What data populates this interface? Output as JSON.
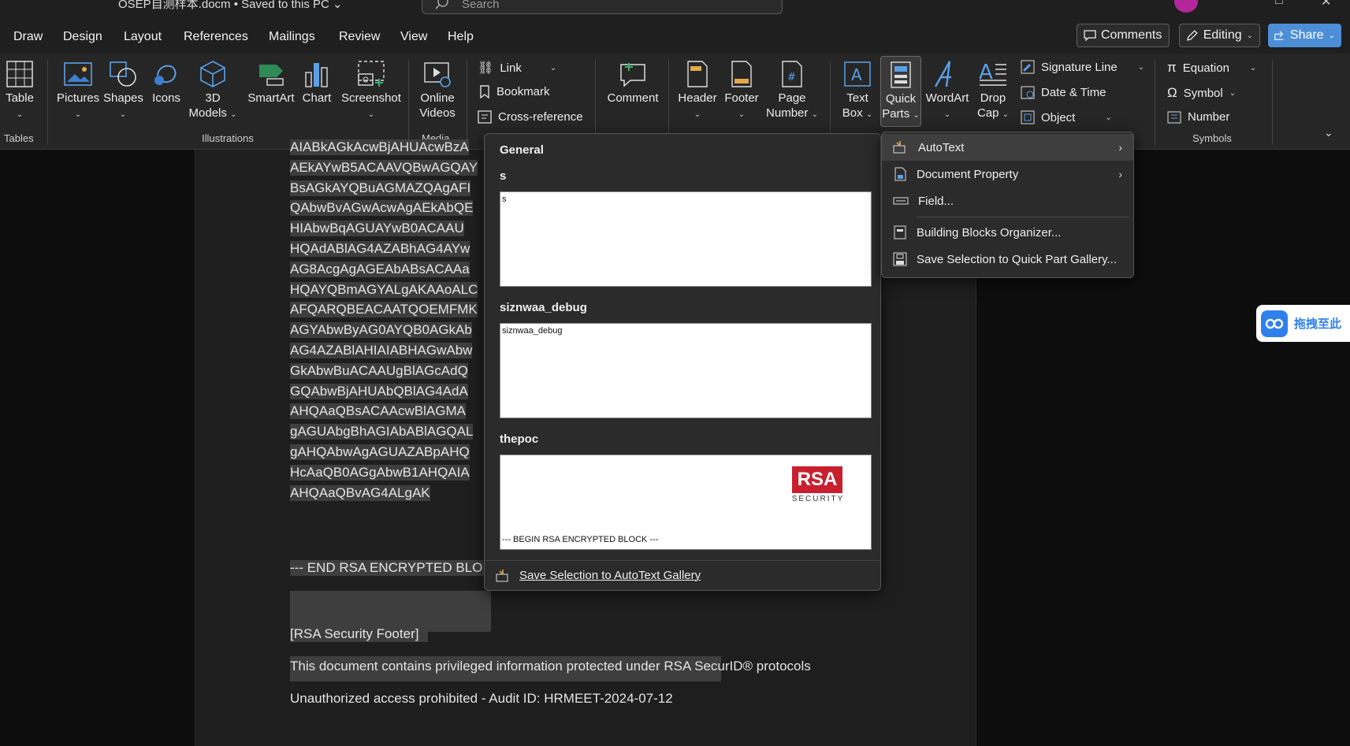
{
  "titlebar": {
    "doc_title": "OSEP自测样本.docm • Saved to this PC ⌄",
    "search_placeholder": "Search"
  },
  "tabs": [
    "Draw",
    "Design",
    "Layout",
    "References",
    "Mailings",
    "Review",
    "View",
    "Help"
  ],
  "top_buttons": {
    "comments": "Comments",
    "editing": "Editing",
    "share": "Share"
  },
  "ribbon": {
    "table": "Table",
    "pictures": "Pictures",
    "shapes": "Shapes",
    "icons": "Icons",
    "models_3d_line1": "3D",
    "models_3d_line2": "Models",
    "smartart": "SmartArt",
    "chart": "Chart",
    "screenshot": "Screenshot",
    "online_videos_line1": "Online",
    "online_videos_line2": "Videos",
    "link": "Link",
    "bookmark": "Bookmark",
    "cross_reference": "Cross-reference",
    "comment": "Comment",
    "header": "Header",
    "footer": "Footer",
    "page_number_line1": "Page",
    "page_number_line2": "Number",
    "text_box_line1": "Text",
    "text_box_line2": "Box",
    "quick_parts_line1": "Quick",
    "quick_parts_line2": "Parts",
    "wordart": "WordArt",
    "drop_cap_line1": "Drop",
    "drop_cap_line2": "Cap",
    "signature_line": "Signature Line",
    "date_time": "Date & Time",
    "object": "Object",
    "equation": "Equation",
    "symbol": "Symbol",
    "number": "Number",
    "groups": {
      "tables": "Tables",
      "illustrations": "Illustrations",
      "media": "Media",
      "symbols": "Symbols"
    }
  },
  "document": {
    "lines": [
      "AIABkAGkAcwBjAHUAcwBzA",
      "AEkAYwB5ACAAVQBwAGQAY",
      "BsAGkAYQBuAGMAZQAgAFI",
      "QAbwBvAGwAcwAgAEkAbQE",
      "HIAbwBqAGUAYwB0ACAAU",
      "HQAdABlAG4AZABhAG4AYw",
      "AG8AcgAgAGEAbABsACAAa",
      "HQAYQBmAGYALgAKAAoALC",
      "AFQARQBEACAATQOEMFMK",
      "AGYAbwByAG0AYQB0AGkAb",
      "AG4AZABlAHIAIABHAGwAbw",
      "GkAbwBuACAAUgBlAGcAdQ",
      "GQAbwBjAHUAbQBlAG4AdA",
      "AHQAaQBsACAAcwBlAGMA",
      "gAGUAbgBhAGIAbABlAGQAL",
      "gAHQAbwAgAGUAZABpAHQ",
      "HcAaQB0AGgAbwB1AHQAIA",
      "AHQAaQBvAG4ALgAK"
    ],
    "end_block": "--- END RSA ENCRYPTED BLO",
    "footer_tag": "[RSA Security Footer]",
    "privileged": "This document contains privileged information protected under RSA SecurID® protocols",
    "unauthorized": "Unauthorized access prohibited - Audit ID: HRMEET-2024-07-12"
  },
  "gallery": {
    "section": "General",
    "entries": [
      {
        "name": "s",
        "preview_text": "s"
      },
      {
        "name": "siznwaa_debug",
        "preview_text": "siznwaa_debug"
      },
      {
        "name": "thepoc",
        "preview_text": "--- BEGIN RSA ENCRYPTED BLOCK ---",
        "logo_text": "RSA",
        "logo_sub": "SECURITY"
      }
    ],
    "footer": "Save Selection to AutoText Gallery"
  },
  "quick_parts_menu": {
    "items": [
      {
        "label": "AutoText",
        "submenu": true,
        "icon": "autotext-icon"
      },
      {
        "label": "Document Property",
        "submenu": true,
        "icon": "document-property-icon"
      },
      {
        "label": "Field...",
        "submenu": false,
        "icon": "field-icon"
      },
      {
        "label": "Building Blocks Organizer...",
        "submenu": false,
        "icon": "building-blocks-icon"
      },
      {
        "label": "Save Selection to Quick Part Gallery...",
        "submenu": false,
        "icon": "save-quick-part-icon"
      }
    ]
  },
  "cloud_widget": {
    "text": "拖拽至此"
  },
  "colors": {
    "accent": "#4d8fd6",
    "rsa_red": "#c8202f",
    "ribbon_bg": "#262626",
    "page_bg": "#1e1e1e"
  }
}
